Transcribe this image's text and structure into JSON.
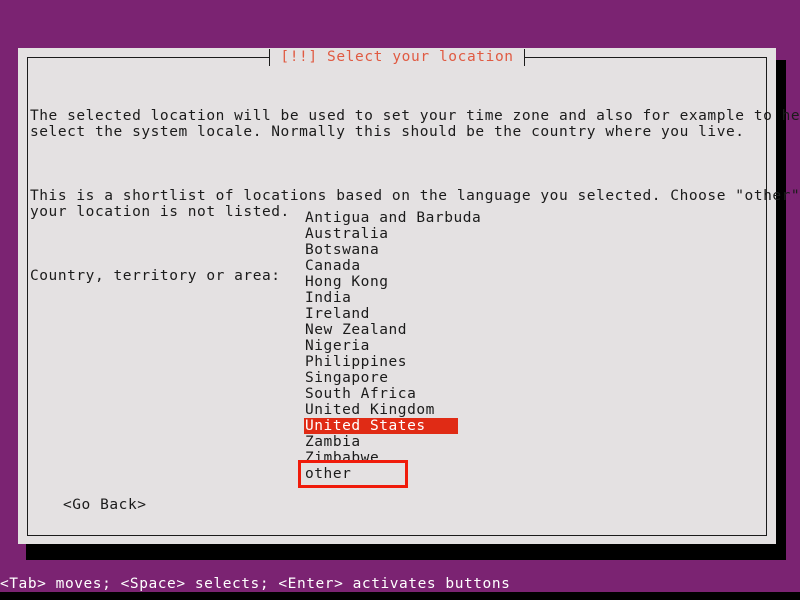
{
  "screen": {
    "background_color": "#7b2372",
    "shadow_color": "#000000"
  },
  "dialog": {
    "title": "[!!] Select your location",
    "title_color": "#e05a42",
    "background_color": "#e4e1e2",
    "border_color": "#1b1b1b",
    "paragraphs": [
      "The selected location will be used to set your time zone and also for example to help\nselect the system locale. Normally this should be the country where you live.",
      "This is a shortlist of locations based on the language you selected. Choose \"other\" if\nyour location is not listed."
    ],
    "list_label": "Country, territory or area:",
    "list": {
      "items": [
        "Antigua and Barbuda",
        "Australia",
        "Botswana",
        "Canada",
        "Hong Kong",
        "India",
        "Ireland",
        "New Zealand",
        "Nigeria",
        "Philippines",
        "Singapore",
        "South Africa",
        "United Kingdom",
        "United States",
        "Zambia",
        "Zimbabwe",
        "other"
      ],
      "selected_item": "United States",
      "selected_index": 13,
      "selected_background_color": "#e02b15",
      "selected_text_color": "#ffffff",
      "cursor_item": "other",
      "cursor_index": 16,
      "cursor_outline_color": "#f01b0b"
    },
    "buttons": [
      {
        "label": "<Go Back>"
      }
    ]
  },
  "statusbar": {
    "text": "<Tab> moves; <Space> selects; <Enter> activates buttons",
    "text_color": "#ffffff"
  }
}
